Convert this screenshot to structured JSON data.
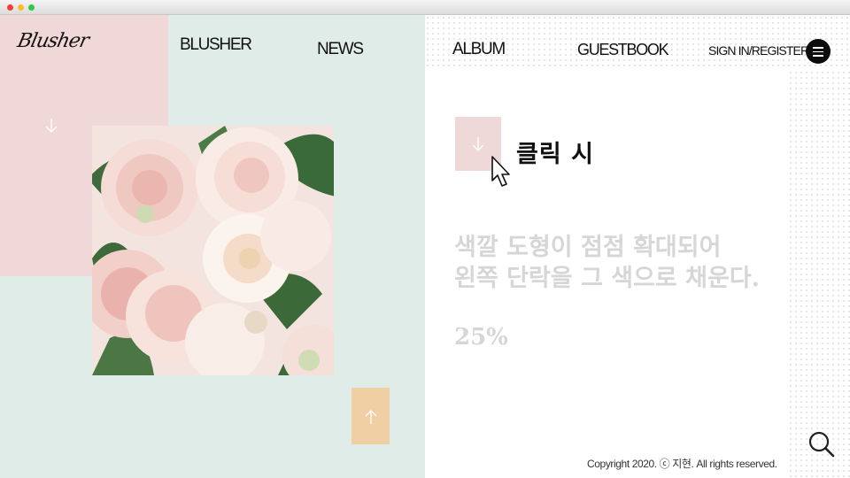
{
  "window": {
    "controls": [
      "close",
      "minimize",
      "maximize"
    ]
  },
  "logo": {
    "text": "Blusher"
  },
  "nav": {
    "brand": "BLUSHER",
    "news": "NEWS",
    "album": "ALBUM",
    "guestbook": "GUESTBOOK",
    "sign_in": "SIGN IN/REGISTER",
    "menu_icon": "hamburger-menu-icon"
  },
  "hero": {
    "image_icon": "peony-flower-photo",
    "arrow_down_icon": "arrow-down-icon",
    "arrow_up_icon": "arrow-up-icon"
  },
  "interaction": {
    "click_label": "클릭 시",
    "description_line1": "색깔 도형이 점점 확대되어",
    "description_line2": "왼쪽 단락을 그 색으로 채운다.",
    "percent": "25%"
  },
  "footer": {
    "copyright": "Copyright 2020. ⓒ 지현. All rights reserved.",
    "search_icon": "search-icon"
  },
  "colors": {
    "mint": "#e0ece7",
    "pink": "#f0d7d8",
    "peach": "#f0cfa4",
    "muted_text": "#d6d6d6"
  }
}
